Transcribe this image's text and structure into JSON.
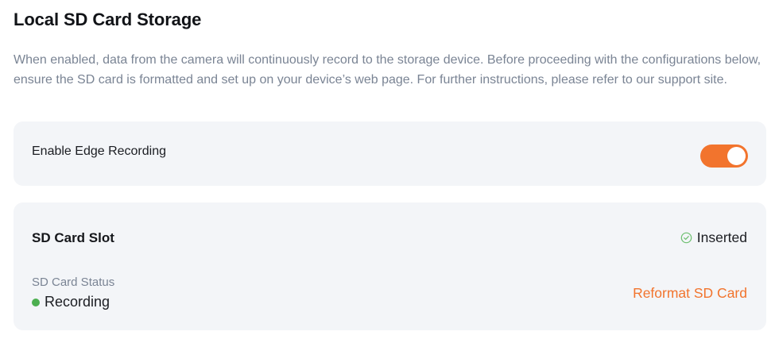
{
  "section": {
    "title": "Local SD Card Storage",
    "description": "When enabled, data from the camera will continuously record to the storage device. Before proceeding with the configurations below, ensure the SD card is formatted and set up on your device’s web page. For further instructions, please refer to our support site."
  },
  "edge_recording": {
    "label": "Enable Edge Recording",
    "enabled": true,
    "toggle_color": "#f2742d"
  },
  "sd_card": {
    "slot_label": "SD Card Slot",
    "slot_state": "Inserted",
    "slot_state_icon": "check-circle-icon",
    "status_label": "SD Card Status",
    "status_value": "Recording",
    "status_color": "#4caf50",
    "reformat_label": "Reformat SD Card",
    "accent_color": "#f2742d"
  }
}
